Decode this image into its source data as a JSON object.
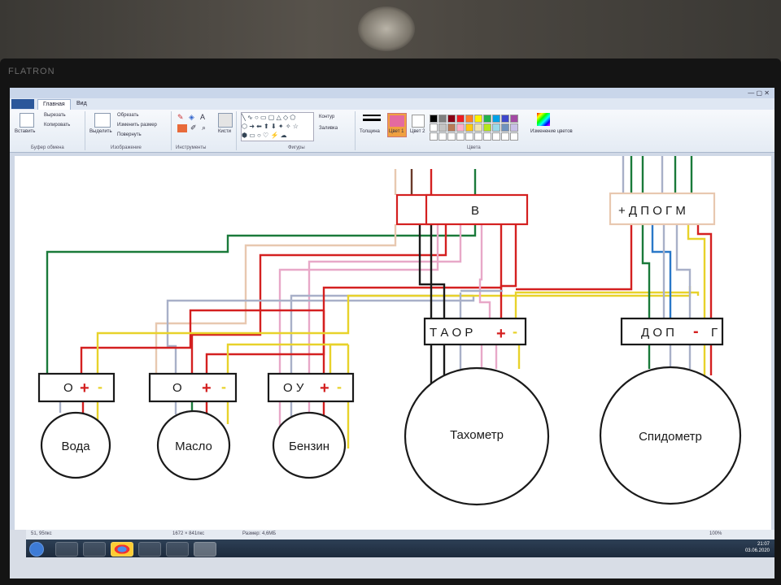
{
  "monitor": {
    "brand": "FLATRON"
  },
  "window": {
    "controls": "— ▢ ✕"
  },
  "tabs": [
    "Главная",
    "Вид"
  ],
  "ribbon": {
    "paste": "Вставить",
    "cut": "Вырезать",
    "copy": "Копировать",
    "select": "Выделить",
    "crop": "Обрезать",
    "resize": "Изменить размер",
    "rotate": "Повернуть",
    "brushes": "Кисти",
    "outline": "Контур",
    "fill": "Заливка",
    "thickness": "Толщина",
    "color1": "Цвет 1",
    "color2": "Цвет 2",
    "edit_colors": "Изменение цветов",
    "groups": [
      "Буфер обмена",
      "Изображение",
      "Инструменты",
      "Фигуры",
      "Цвета"
    ],
    "palette": [
      "#000000",
      "#7f7f7f",
      "#880015",
      "#ed1c24",
      "#ff7f27",
      "#fff200",
      "#22b14c",
      "#00a2e8",
      "#3f48cc",
      "#a349a4",
      "#ffffff",
      "#c3c3c3",
      "#b97a57",
      "#ffaec9",
      "#ffc90e",
      "#efe4b0",
      "#b5e61d",
      "#99d9ea",
      "#7092be",
      "#c8bfe7"
    ],
    "color1_value": "#e46aa0"
  },
  "diagram": {
    "blocks": {
      "B": "В",
      "top_right": "+ Д П О Г М",
      "tacho": "Т А О  Р",
      "speedo": "Д О П",
      "speedo_g": "Г",
      "water": "О",
      "oil": "О",
      "fuel": "О  У"
    },
    "plus": "+",
    "minus": "-",
    "gauges": [
      "Вода",
      "Масло",
      "Бензин",
      "Тахометр",
      "Спидометр"
    ]
  },
  "status": {
    "cursor": "51, 95пкс",
    "dims": "1672 × 841пкс",
    "size": "Размер: 4,6МБ",
    "zoom": "100%"
  },
  "clock": {
    "time": "21:07",
    "date": "03.06.2020"
  },
  "colors": {
    "red": "#d42020",
    "yellow": "#e8d22a",
    "green": "#1a7a3a",
    "grey": "#a8b0c8",
    "pink": "#e8a8c8",
    "black": "#1a1a1a",
    "brown": "#6a3a2a",
    "peach": "#e8c8b0",
    "blue": "#2a78c8"
  }
}
